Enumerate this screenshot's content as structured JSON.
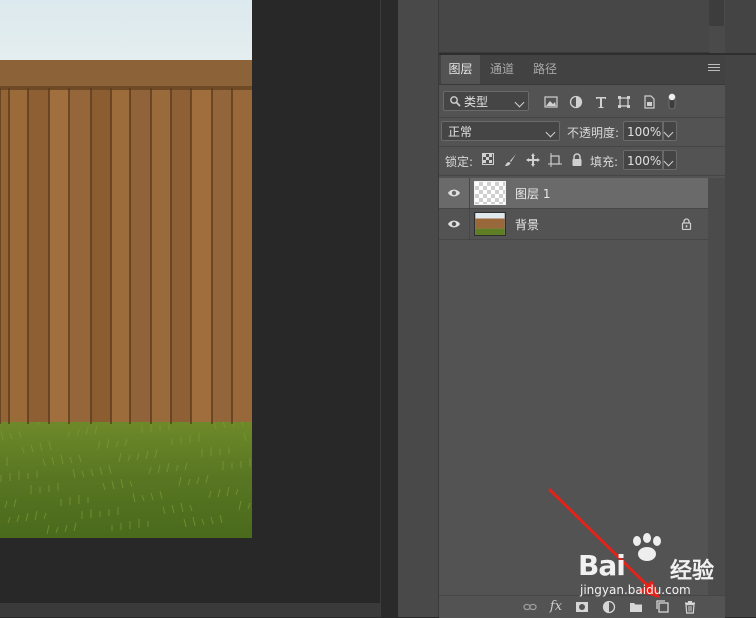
{
  "tabs": [
    {
      "label": "图层",
      "active": true
    },
    {
      "label": "通道",
      "active": false
    },
    {
      "label": "路径",
      "active": false
    }
  ],
  "filter": {
    "kind_label": "类型"
  },
  "blend": {
    "mode": "正常",
    "opacity_label": "不透明度:",
    "opacity_value": "100%"
  },
  "lock": {
    "label": "锁定:",
    "fill_label": "填充:",
    "fill_value": "100%"
  },
  "layers": [
    {
      "name": "图层 1",
      "selected": true,
      "locked": false,
      "visible": true
    },
    {
      "name": "背景",
      "selected": false,
      "locked": true,
      "visible": true
    }
  ],
  "bottom_icons": [
    "link-icon",
    "fx-icon",
    "mask-icon",
    "adjustment-icon",
    "folder-icon",
    "new-layer-icon",
    "trash-icon"
  ],
  "fx_label": "fx",
  "watermark": {
    "brand": "Bai",
    "brand2": "经验",
    "url": "jingyan.baidu.com"
  },
  "colors": {
    "panel": "#535353",
    "selected_row": "#6a6a6a",
    "arrow": "#e2231a",
    "canvas_bg": "#282828"
  }
}
